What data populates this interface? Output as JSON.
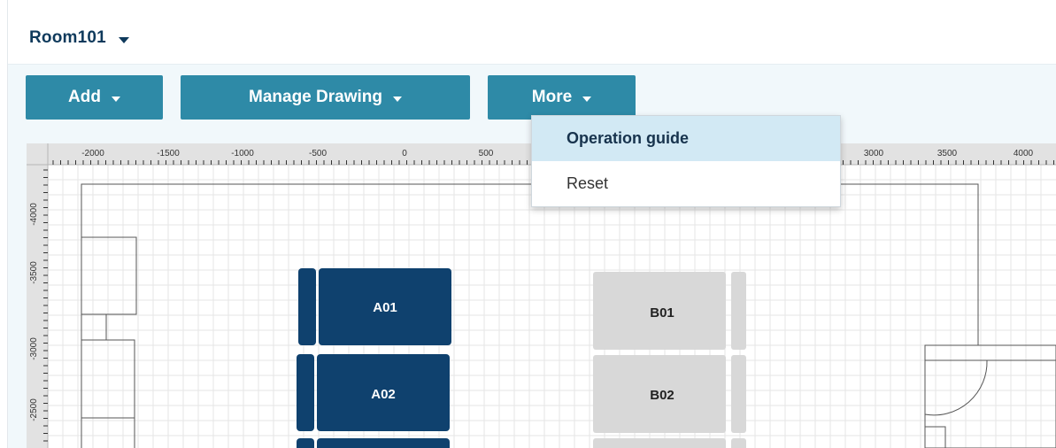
{
  "header": {
    "room_name": "Room101"
  },
  "toolbar": {
    "add_label": "Add",
    "manage_drawing_label": "Manage Drawing",
    "more_label": "More"
  },
  "more_menu": {
    "items": [
      {
        "label": "Operation guide",
        "active": true
      },
      {
        "label": "Reset",
        "active": false
      }
    ]
  },
  "ruler": {
    "x_labels": [
      "-2000",
      "-1500",
      "-1000",
      "-500",
      "0",
      "500",
      "3000",
      "3500",
      "4000"
    ],
    "y_labels": [
      "-4000",
      "-3500",
      "-3000",
      "-2500"
    ]
  },
  "racks": [
    {
      "label": "A01",
      "state": "selected"
    },
    {
      "label": "A02",
      "state": "selected"
    },
    {
      "label": "B01",
      "state": "normal"
    },
    {
      "label": "B02",
      "state": "normal"
    }
  ],
  "colors": {
    "accent": "#2e8aa7",
    "title": "#0f3a5c",
    "rack_selected": "#0f416e",
    "rack_normal": "#d8d8d8",
    "menu_highlight": "#d2e9f4"
  }
}
